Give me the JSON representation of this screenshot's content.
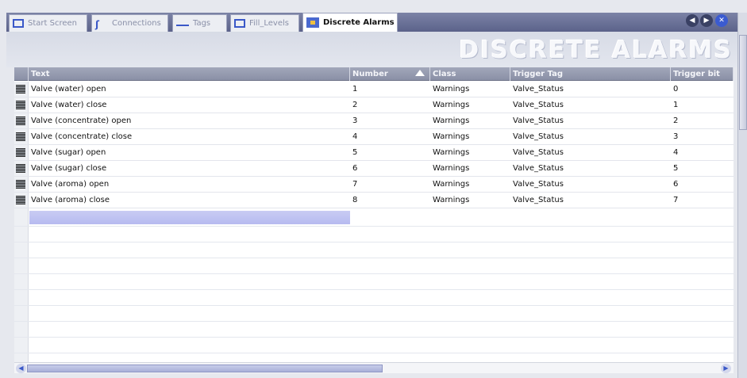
{
  "tabs": [
    {
      "label": "Start Screen",
      "icon": "screen-icon"
    },
    {
      "label": "Connections",
      "icon": "connections-icon"
    },
    {
      "label": "Tags",
      "icon": "tags-icon"
    },
    {
      "label": "Fill_Levels",
      "icon": "screen-icon"
    },
    {
      "label": "Discrete Alarms",
      "icon": "alarm-editor-icon",
      "active": true
    }
  ],
  "nav": {
    "prev": "◀",
    "next": "▶",
    "close": "✕"
  },
  "banner": {
    "title": "DISCRETE ALARMS"
  },
  "table": {
    "columns": [
      "Text",
      "Number",
      "Class",
      "Trigger Tag",
      "Trigger bit"
    ],
    "sorted_column": "Number",
    "rows": [
      {
        "text": "Valve (water) open",
        "number": "1",
        "class": "Warnings",
        "trigger_tag": "Valve_Status",
        "trigger_bit": "0"
      },
      {
        "text": "Valve (water) close",
        "number": "2",
        "class": "Warnings",
        "trigger_tag": "Valve_Status",
        "trigger_bit": "1"
      },
      {
        "text": "Valve (concentrate) open",
        "number": "3",
        "class": "Warnings",
        "trigger_tag": "Valve_Status",
        "trigger_bit": "2"
      },
      {
        "text": "Valve (concentrate) close",
        "number": "4",
        "class": "Warnings",
        "trigger_tag": "Valve_Status",
        "trigger_bit": "3"
      },
      {
        "text": "Valve (sugar) open",
        "number": "5",
        "class": "Warnings",
        "trigger_tag": "Valve_Status",
        "trigger_bit": "4"
      },
      {
        "text": "Valve (sugar) close",
        "number": "6",
        "class": "Warnings",
        "trigger_tag": "Valve_Status",
        "trigger_bit": "5"
      },
      {
        "text": "Valve (aroma) open",
        "number": "7",
        "class": "Warnings",
        "trigger_tag": "Valve_Status",
        "trigger_bit": "6"
      },
      {
        "text": "Valve (aroma) close",
        "number": "8",
        "class": "Warnings",
        "trigger_tag": "Valve_Status",
        "trigger_bit": "7"
      }
    ]
  },
  "scrollbar": {
    "left": "◀",
    "right": "▶"
  },
  "colors": {
    "accent": "#3a58c8",
    "header": "#8a90a6",
    "selection": "#b6baf0"
  }
}
